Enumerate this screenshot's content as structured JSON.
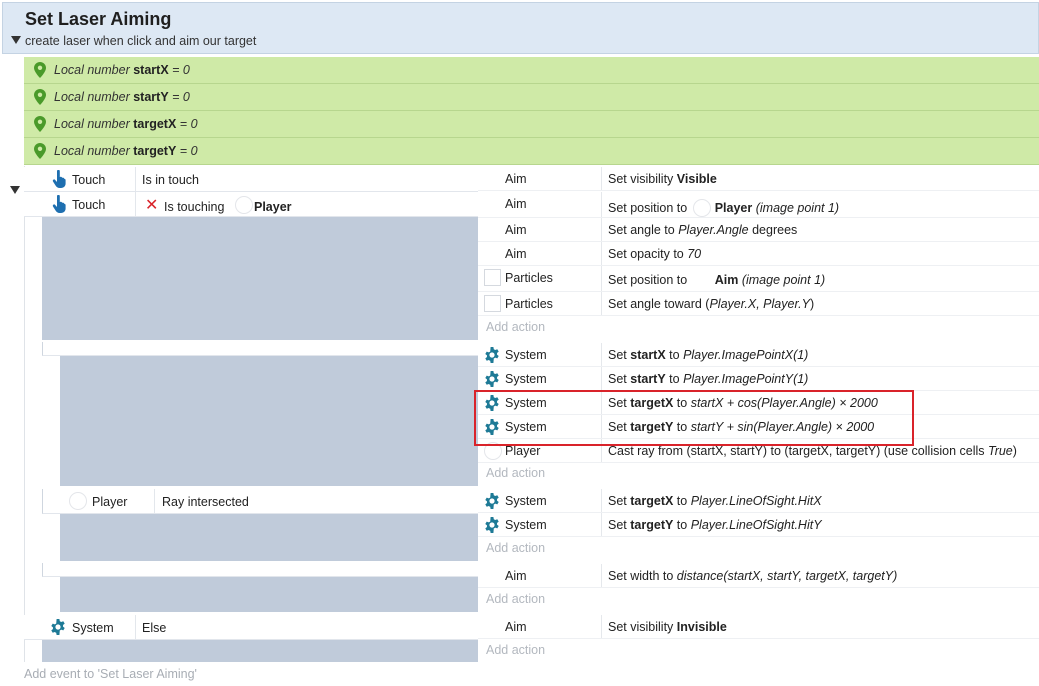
{
  "group": {
    "title": "Set Laser Aiming",
    "description": "create laser when click and aim our target"
  },
  "local_vars": [
    {
      "prefix": "Local number",
      "name": "startX",
      "value": "= 0"
    },
    {
      "prefix": "Local number",
      "name": "startY",
      "value": "= 0"
    },
    {
      "prefix": "Local number",
      "name": "targetX",
      "value": "= 0"
    },
    {
      "prefix": "Local number",
      "name": "targetY",
      "value": "= 0"
    }
  ],
  "event1": {
    "conditions": [
      {
        "object": "Touch",
        "text": "Is in touch"
      },
      {
        "object": "Touch",
        "text": "Is touching",
        "target": "Player"
      }
    ],
    "actions": [
      {
        "object": "Aim",
        "pre": "Set visibility ",
        "bold": "Visible"
      },
      {
        "object": "Aim",
        "pre": "Set position to ",
        "bold": "Player",
        "italic": "(image point 1)"
      },
      {
        "object": "Aim",
        "pre": "Set angle to ",
        "italic": "Player.Angle",
        "post": " degrees"
      },
      {
        "object": "Aim",
        "pre": "Set opacity to ",
        "italic": "70"
      },
      {
        "object": "Particles",
        "pre": "Set position to ",
        "bold": "Aim",
        "italic": "(image point 1)"
      },
      {
        "object": "Particles",
        "pre": "Set angle toward (",
        "italic": "Player.X, Player.Y",
        "post": ")"
      }
    ]
  },
  "event2": {
    "actions": [
      {
        "object": "System",
        "pre": "Set ",
        "bold": "startX",
        "mid": " to ",
        "italic": "Player.ImagePointX(1)"
      },
      {
        "object": "System",
        "pre": "Set ",
        "bold": "startY",
        "mid": " to ",
        "italic": "Player.ImagePointY(1)"
      },
      {
        "object": "System",
        "pre": "Set ",
        "bold": "targetX",
        "mid": " to ",
        "italic": "startX + cos(Player.Angle) × 2000"
      },
      {
        "object": "System",
        "pre": "Set ",
        "bold": "targetY",
        "mid": " to ",
        "italic": "startY + sin(Player.Angle) × 2000"
      },
      {
        "object": "Player",
        "pre": "Cast ray from (startX, startY) to (targetX, targetY) (use collision cells ",
        "italic": "True",
        "post": ")"
      }
    ]
  },
  "event3": {
    "condition": {
      "object": "Player",
      "text": "Ray intersected"
    },
    "actions": [
      {
        "object": "System",
        "pre": "Set ",
        "bold": "targetX",
        "mid": " to ",
        "italic": "Player.LineOfSight.HitX"
      },
      {
        "object": "System",
        "pre": "Set ",
        "bold": "targetY",
        "mid": " to ",
        "italic": "Player.LineOfSight.HitY"
      }
    ]
  },
  "event4": {
    "actions": [
      {
        "object": "Aim",
        "pre": "Set width to ",
        "italic": "distance(startX, startY, targetX, targetY)"
      }
    ]
  },
  "event5": {
    "condition": {
      "object": "System",
      "text": "Else"
    },
    "actions": [
      {
        "object": "Aim",
        "pre": "Set visibility ",
        "bold": "Invisible"
      }
    ]
  },
  "add_action": "Add action",
  "add_event": "Add event to 'Set Laser Aiming'",
  "colors": {
    "highlight": "#d9232a",
    "gear": "#1e7a96",
    "var_bg": "#cfeaa7",
    "pin": "#4a9a2a",
    "x": "#d9232a"
  }
}
